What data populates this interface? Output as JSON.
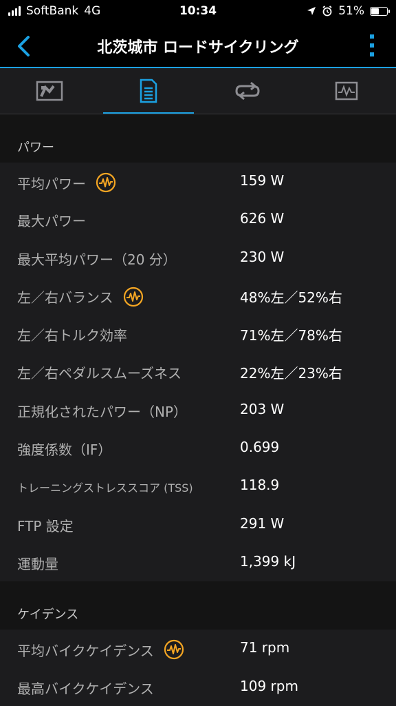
{
  "status_bar": {
    "carrier": "SoftBank",
    "network": "4G",
    "time": "10:34",
    "battery": "51%",
    "icons": [
      "signal-icon",
      "location-arrow-icon",
      "alarm-icon",
      "battery-icon"
    ]
  },
  "app_bar": {
    "title": "北茨城市 ロードサイクリング",
    "back_icon": "chevron-left-icon",
    "more_icon": "more-vertical-icon"
  },
  "tabs": [
    {
      "name": "overview",
      "icon": "map-overview-icon",
      "active": false
    },
    {
      "name": "stats",
      "icon": "document-list-icon",
      "active": true
    },
    {
      "name": "laps",
      "icon": "loop-arrows-icon",
      "active": false
    },
    {
      "name": "charts",
      "icon": "chart-pulse-icon",
      "active": false
    }
  ],
  "colors": {
    "accent": "#1ba1e2",
    "badge": "#f5a623",
    "background": "#1c1c1e",
    "section_bg": "#141414"
  },
  "sections": {
    "power": {
      "title": "パワー",
      "rows": [
        {
          "label": "平均パワー",
          "value": "159 W",
          "badge": true
        },
        {
          "label": "最大パワー",
          "value": "626 W",
          "badge": false
        },
        {
          "label": "最大平均パワー（20 分）",
          "value": "230 W",
          "badge": false
        },
        {
          "label": "左／右バランス",
          "value": "48%左／52%右",
          "badge": true
        },
        {
          "label": "左／右トルク効率",
          "value": "71%左／78%右",
          "badge": false
        },
        {
          "label": "左／右ペダルスムーズネス",
          "value": "22%左／23%右",
          "badge": false
        },
        {
          "label": "正規化されたパワー（NP）",
          "value": "203 W",
          "badge": false
        },
        {
          "label": "強度係数（IF）",
          "value": "0.699",
          "badge": false
        },
        {
          "label": "トレーニングストレススコア (TSS)",
          "value": "118.9",
          "badge": false
        },
        {
          "label": "FTP 設定",
          "value": "291 W",
          "badge": false
        },
        {
          "label": "運動量",
          "value": "1,399 kJ",
          "badge": false
        }
      ]
    },
    "cadence": {
      "title": "ケイデンス",
      "rows": [
        {
          "label": "平均バイクケイデンス",
          "value": "71 rpm",
          "badge": true
        },
        {
          "label": "最高バイクケイデンス",
          "value": "109 rpm",
          "badge": false
        }
      ]
    }
  }
}
